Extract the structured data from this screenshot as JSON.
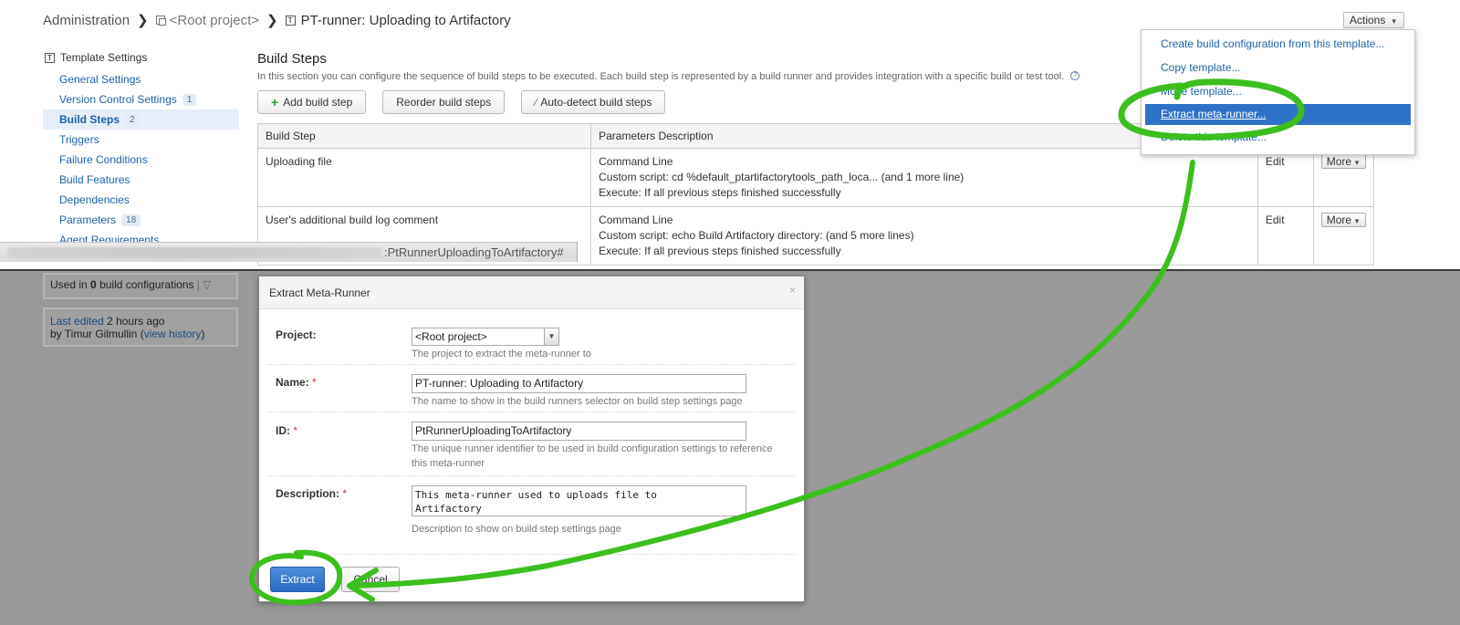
{
  "breadcrumb": {
    "root": "Administration",
    "project": "<Root project>",
    "current": "PT-runner: Uploading to Artifactory"
  },
  "actions": {
    "label": "Actions",
    "menu": [
      "Create build configuration from this template...",
      "Copy template...",
      "Move template...",
      "Extract meta-runner...",
      "Delete this template..."
    ]
  },
  "sidebar": {
    "header": "Template Settings",
    "items": [
      {
        "label": "General Settings",
        "badge": ""
      },
      {
        "label": "Version Control Settings",
        "badge": "1"
      },
      {
        "label": "Build Steps",
        "badge": "2"
      },
      {
        "label": "Triggers",
        "badge": ""
      },
      {
        "label": "Failure Conditions",
        "badge": ""
      },
      {
        "label": "Build Features",
        "badge": ""
      },
      {
        "label": "Dependencies",
        "badge": ""
      },
      {
        "label": "Parameters",
        "badge": "18"
      },
      {
        "label": "Agent Requirements",
        "badge": ""
      }
    ],
    "used_in_prefix": "Used in",
    "used_in_count": "0",
    "used_in_suffix": "build configurations",
    "last_edited": "Last edited",
    "last_edited_time": "2 hours ago",
    "by_user": "by Timur Gilmullin",
    "view_history": "view history"
  },
  "build_steps": {
    "title": "Build Steps",
    "description": "In this section you can configure the sequence of build steps to be executed. Each build step is represented by a build runner and provides integration with a specific build or test tool.",
    "add_label": "Add build step",
    "reorder_label": "Reorder build steps",
    "autodetect_label": "Auto-detect build steps",
    "col_step": "Build Step",
    "col_params": "Parameters Description",
    "rows": [
      {
        "name": "Uploading file",
        "runner": "Command Line",
        "script": "Custom script: cd %default_ptartifactorytools_path_loca... (and 1 more line)",
        "execute": "Execute: If all previous steps finished successfully",
        "edit": "Edit",
        "more": "More"
      },
      {
        "name": "User's additional build log comment",
        "runner": "Command Line",
        "script": "Custom script: echo Build Artifactory directory: (and 5 more lines)",
        "execute": "Execute: If all previous steps finished successfully",
        "edit": "Edit",
        "more": "More"
      }
    ]
  },
  "statusbar": {
    "url_fragment": ":PtRunnerUploadingToArtifactory#"
  },
  "dialog": {
    "title": "Extract Meta-Runner",
    "close": "×",
    "project_label": "Project:",
    "project_value": "<Root project>",
    "project_note": "The project to extract the meta-runner to",
    "name_label": "Name:",
    "name_value": "PT-runner: Uploading to Artifactory",
    "name_note": "The name to show in the build runners selector on build step settings page",
    "id_label": "ID:",
    "id_value": "PtRunnerUploadingToArtifactory",
    "id_note_1": "The unique runner identifier to be used in build configuration settings to reference",
    "id_note_2": "this meta-runner",
    "desc_label": "Description:",
    "desc_value": "This meta-runner used to uploads file to\nArtifactory",
    "desc_note": "Description to show on build step settings page",
    "required_mark": "*",
    "extract_label": "Extract",
    "cancel_label": "Cancel"
  },
  "colors": {
    "link": "#1d61a9",
    "highlight": "#2f73c9",
    "annotation": "#3cbf1e",
    "overlay": "#999999"
  }
}
